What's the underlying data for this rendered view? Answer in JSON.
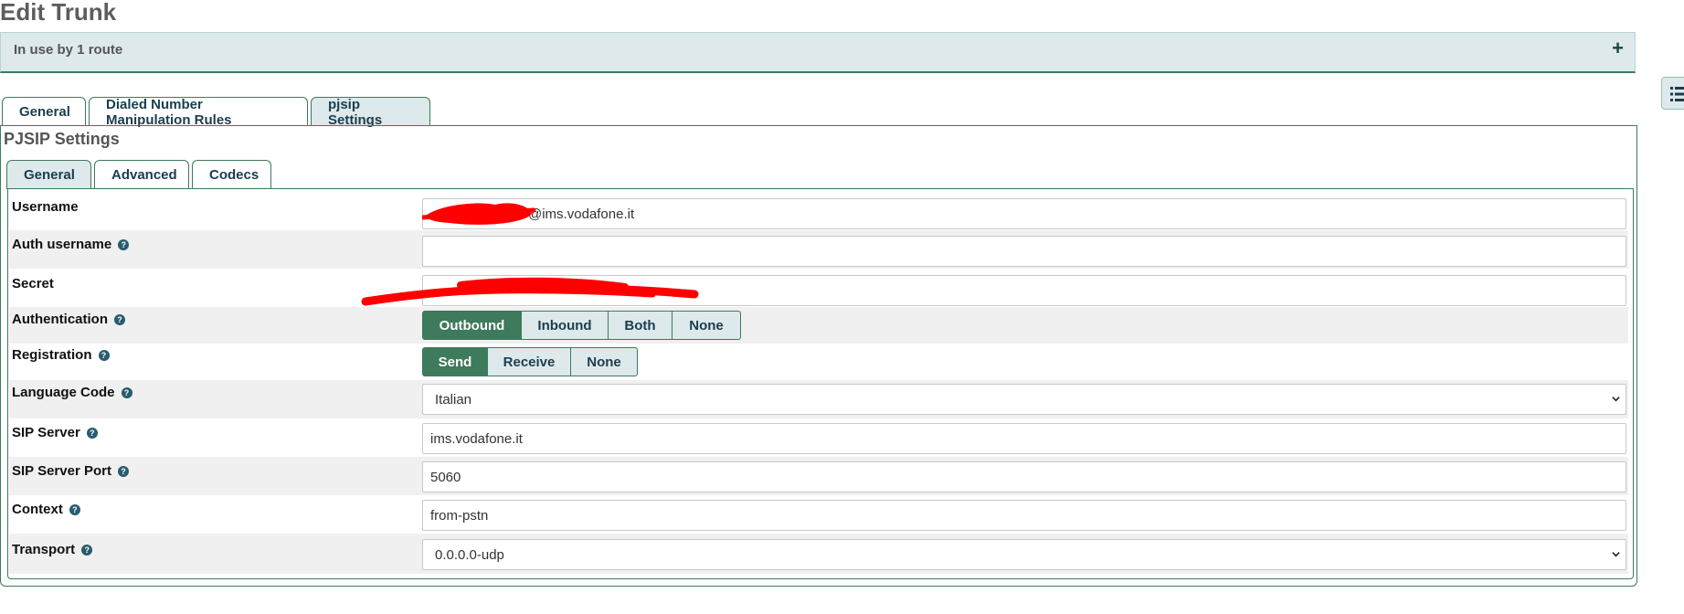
{
  "page": {
    "title": "Edit Trunk"
  },
  "usage": {
    "text": "In use by 1 route",
    "expand_symbol": "+"
  },
  "outer_tabs": [
    {
      "label": "General",
      "active": false
    },
    {
      "label": "Dialed Number Manipulation Rules",
      "active": false
    },
    {
      "label": "pjsip Settings",
      "active": true
    }
  ],
  "section": {
    "title": "PJSIP Settings"
  },
  "inner_tabs": [
    {
      "label": "General",
      "active": true
    },
    {
      "label": "Advanced",
      "active": false
    },
    {
      "label": "Codecs",
      "active": false
    }
  ],
  "form": {
    "username": {
      "label": "Username",
      "value": "@ims.vodafone.it"
    },
    "auth_username": {
      "label": "Auth username",
      "value": ""
    },
    "secret": {
      "label": "Secret",
      "value": ""
    },
    "authentication": {
      "label": "Authentication",
      "options": [
        "Outbound",
        "Inbound",
        "Both",
        "None"
      ],
      "selected": "Outbound"
    },
    "registration": {
      "label": "Registration",
      "options": [
        "Send",
        "Receive",
        "None"
      ],
      "selected": "Send"
    },
    "language_code": {
      "label": "Language Code",
      "value": "Italian"
    },
    "sip_server": {
      "label": "SIP Server",
      "value": "ims.vodafone.it"
    },
    "sip_server_port": {
      "label": "SIP Server Port",
      "value": "5060"
    },
    "context": {
      "label": "Context",
      "value": "from-pstn"
    },
    "transport": {
      "label": "Transport",
      "value": "0.0.0.0-udp"
    }
  },
  "colors": {
    "accent": "#3e7a5c",
    "tab_active_bg": "#dde9ea",
    "redaction": "#ff0000",
    "help_icon": "#285c6e"
  },
  "icons": {
    "help": "help-icon",
    "expand": "plus-icon",
    "side_toggle": "list-icon",
    "dropdown": "chevron-down-icon"
  }
}
